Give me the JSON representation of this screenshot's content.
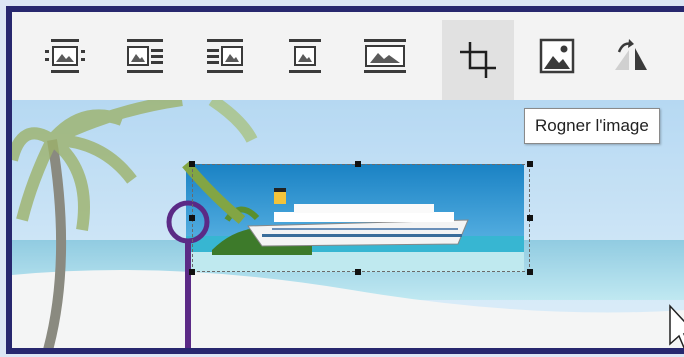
{
  "toolbar": {
    "buttons": [
      {
        "name": "wrap-inline-icon"
      },
      {
        "name": "wrap-square-icon"
      },
      {
        "name": "wrap-right-icon"
      },
      {
        "name": "wrap-top-bottom-icon"
      },
      {
        "name": "wrap-behind-icon"
      },
      {
        "name": "crop-icon"
      },
      {
        "name": "change-picture-icon"
      },
      {
        "name": "rotate-icon"
      }
    ]
  },
  "tooltip": {
    "text": "Rogner l'image"
  },
  "colors": {
    "frame": "#27276e",
    "callout": "#5b2a86",
    "sky": "#9fd0ef",
    "sea": "#3ab0cf",
    "sand": "#eef0f0"
  }
}
